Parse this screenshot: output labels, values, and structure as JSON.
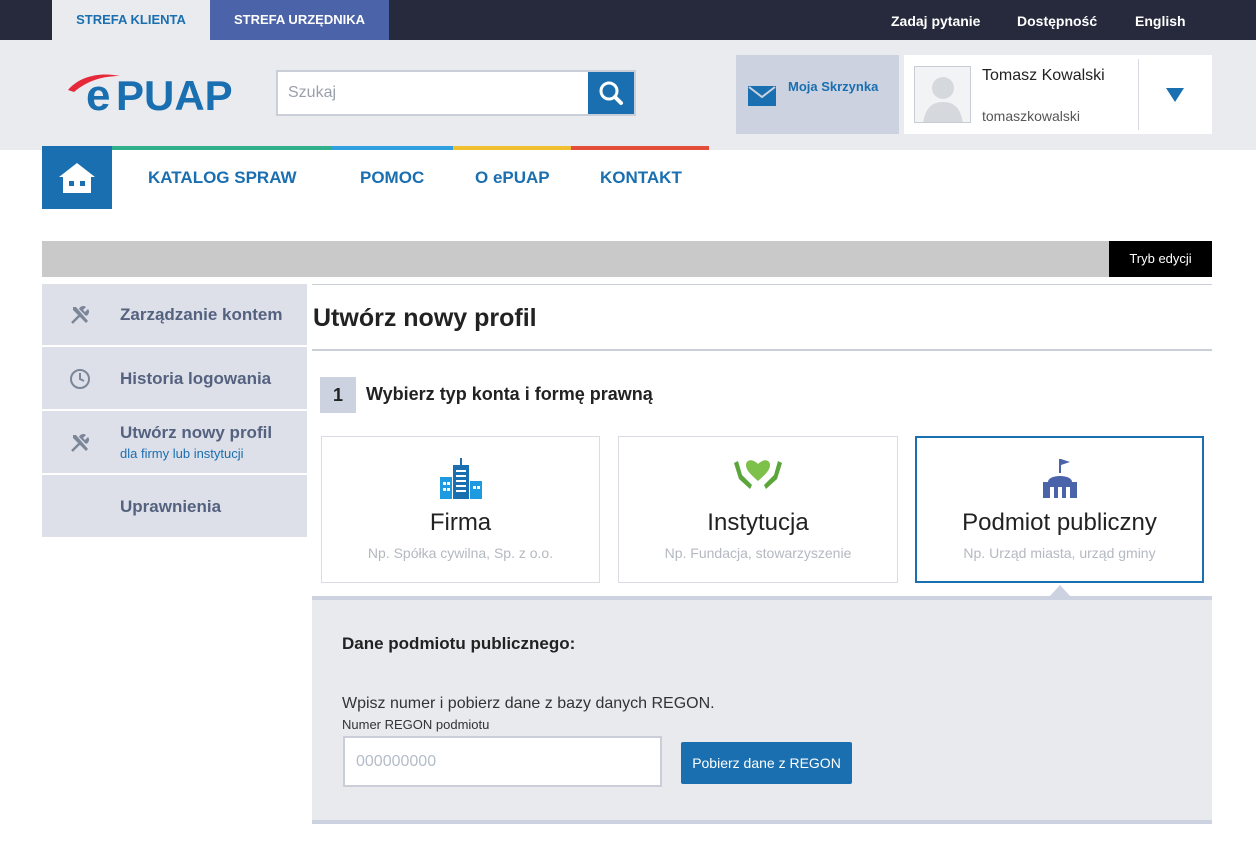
{
  "topbar": {
    "tab_client": "STREFA KLIENTA",
    "tab_official": "STREFA URZĘDNIKA",
    "ask_question": "Zadaj pytanie",
    "accessibility": "Dostępność",
    "language": "English"
  },
  "header": {
    "logo_text": "ePUAP",
    "search_placeholder": "Szukaj",
    "inbox_label": "Moja Skrzynka",
    "user_name": "Tomasz Kowalski",
    "user_login": "tomaszkowalski"
  },
  "nav": {
    "items": [
      "KATALOG SPRAW",
      "POMOC",
      "O ePUAP",
      "KONTAKT"
    ]
  },
  "edit_mode_label": "Tryb edycji",
  "sidebar": {
    "items": [
      {
        "label": "Zarządzanie kontem",
        "icon": "tools-icon"
      },
      {
        "label": "Historia logowania",
        "icon": "clock-icon"
      },
      {
        "label": "Utwórz nowy profil",
        "sublabel": "dla firmy lub instytucji",
        "icon": "tools-icon"
      },
      {
        "label": "Uprawnienia"
      }
    ]
  },
  "main": {
    "title": "Utwórz nowy profil",
    "step_number": "1",
    "step_title": "Wybierz typ konta i formę prawną",
    "cards": [
      {
        "title": "Firma",
        "subtitle": "Np. Spółka cywilna, Sp. z o.o.",
        "icon": "buildings-icon",
        "selected": false
      },
      {
        "title": "Instytucja",
        "subtitle": "Np. Fundacja, stowarzyszenie",
        "icon": "heart-hands-icon",
        "selected": false
      },
      {
        "title": "Podmiot publiczny",
        "subtitle": "Np. Urząd miasta, urząd gminy",
        "icon": "public-building-icon",
        "selected": true
      }
    ],
    "panel": {
      "heading": "Dane podmiotu publicznego:",
      "instruction": "Wpisz numer i pobierz dane z bazy danych REGON.",
      "field_label": "Numer REGON podmiotu",
      "field_placeholder": "000000000",
      "button_label": "Pobierz dane z REGON"
    }
  },
  "colors": {
    "primary": "#1a6fb0",
    "topbar": "#262a3c",
    "official_tab": "#4b63a8",
    "strip": [
      "#2fb08a",
      "#2f9fe0",
      "#f0c030",
      "#e54d3b"
    ]
  }
}
